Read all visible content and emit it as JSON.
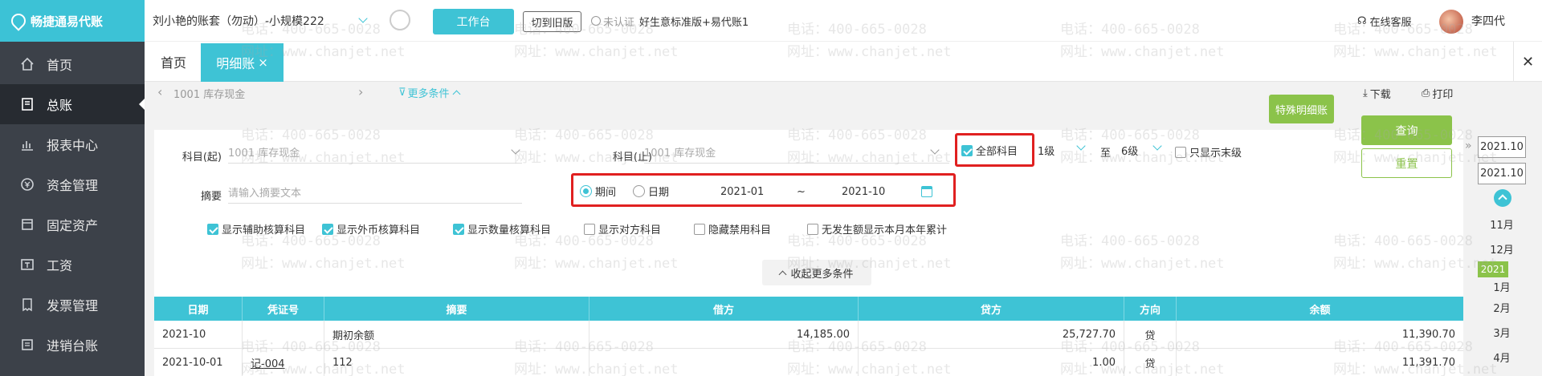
{
  "app": {
    "logo_text": "畅捷通易代账"
  },
  "header": {
    "account_name": "刘小艳的账套（勿动）-小规模222",
    "workbench_label": "工作台",
    "switch_old_label": "切到旧版",
    "uncertified_label": "未认证",
    "product_label": "好生意标准版+易代账1",
    "support_label": "在线客服",
    "user_name": "李四代"
  },
  "sidebar": {
    "items": [
      {
        "label": "首页",
        "icon": "home-icon"
      },
      {
        "label": "总账",
        "icon": "book-icon",
        "active": true
      },
      {
        "label": "报表中心",
        "icon": "chart-icon"
      },
      {
        "label": "资金管理",
        "icon": "money-icon"
      },
      {
        "label": "固定资产",
        "icon": "asset-icon"
      },
      {
        "label": "工资",
        "icon": "salary-icon"
      },
      {
        "label": "发票管理",
        "icon": "invoice-icon"
      },
      {
        "label": "进销台账",
        "icon": "ledger-icon"
      }
    ]
  },
  "tabs": {
    "home": "首页",
    "detail": "明细账",
    "close": "×"
  },
  "toolbar": {
    "prev": "‹",
    "account": "1001 库存现金",
    "next": "›",
    "more_conditions": "更多条件",
    "special_detail": "特殊明细账",
    "download": "下载",
    "print": "打印"
  },
  "filters": {
    "subject_start_label": "科目(起)",
    "subject_start_value": "1001 库存现金",
    "subject_end_label": "科目(止)",
    "subject_end_value": "1001 库存现金",
    "all_subjects_label": "全部科目",
    "level_from": "1级",
    "level_to_label": "至",
    "level_to": "6级",
    "only_last_label": "只显示末级",
    "summary_label": "摘要",
    "summary_placeholder": "请输入摘要文本",
    "period_label": "期间",
    "date_label": "日期",
    "period_start": "2021-01",
    "period_sep": "~",
    "period_end": "2021-10",
    "query_label": "查询",
    "reset_label": "重置",
    "options": [
      {
        "label": "显示辅助核算科目",
        "checked": true
      },
      {
        "label": "显示外币核算科目",
        "checked": true
      },
      {
        "label": "显示数量核算科目",
        "checked": true
      },
      {
        "label": "显示对方科目",
        "checked": false
      },
      {
        "label": "隐藏禁用科目",
        "checked": false
      },
      {
        "label": "无发生额显示本月本年累计",
        "checked": false
      }
    ],
    "collapse_label": "收起更多条件"
  },
  "table": {
    "headers": [
      "日期",
      "凭证号",
      "摘要",
      "借方",
      "贷方",
      "方向",
      "余额"
    ],
    "rows": [
      [
        "2021-10",
        "",
        "期初余额",
        "14,185.00",
        "25,727.70",
        "贷",
        "11,390.70"
      ],
      [
        "2021-10-01",
        "记-004",
        "112",
        "",
        "1.00",
        "贷",
        "11,391.70"
      ]
    ]
  },
  "period_picker": {
    "start": "2021.10",
    "end": "2021.10",
    "months": [
      "11月",
      "12月"
    ],
    "year": "2021",
    "months_after": [
      "1月",
      "2月",
      "3月",
      "4月"
    ]
  },
  "watermark": {
    "phone": "电话：400-665-0028",
    "site": "网址：www.chanjet.net"
  },
  "colors": {
    "accent": "#3ec3d5",
    "green": "#8bc34a",
    "sidebar": "#3c4149",
    "highlight": "#e02020"
  }
}
